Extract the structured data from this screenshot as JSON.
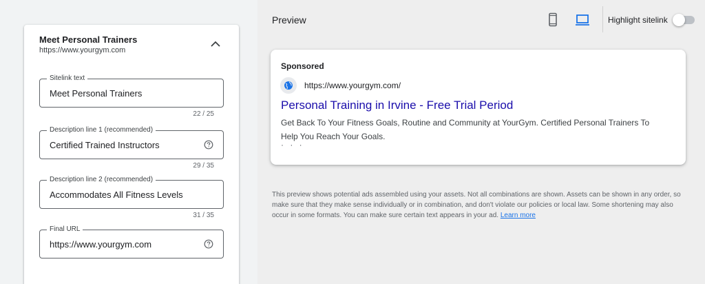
{
  "sitelink": {
    "title": "Meet Personal Trainers",
    "url": "https://www.yourgym.com",
    "collapse_icon": "chevron-up-icon",
    "fields": [
      {
        "label": "Sitelink text",
        "value": "Meet Personal Trainers",
        "counter": "22 / 25",
        "help": false
      },
      {
        "label": "Description line 1 (recommended)",
        "value": "Certified Trained Instructors",
        "counter": "29 / 35",
        "help": true
      },
      {
        "label": "Description line 2 (recommended)",
        "value": "Accommodates All Fitness Levels",
        "counter": "31 / 35",
        "help": false
      },
      {
        "label": "Final URL",
        "value": "https://www.yourgym.com",
        "counter": "",
        "help": true
      }
    ]
  },
  "preview": {
    "title": "Preview",
    "mobile_icon": "mobile-phone-icon",
    "desktop_icon": "laptop-icon",
    "highlight_label": "Highlight sitelink",
    "highlight_on": false,
    "ad": {
      "sponsored": "Sponsored",
      "url": "https://www.yourgym.com/",
      "headline": "Personal Training in Irvine - Free Trial Period",
      "description": "Get Back To Your Fitness Goals, Routine and Community at YourGym. Certified Personal Trainers To Help You Reach Your Goals.",
      "more": "· · ·"
    },
    "disclaimer": "This preview shows potential ads assembled using your assets. Not all combinations are shown. Assets can be shown in any order, so make sure that they make sense individually or in combination, and don't violate our policies or local law. Some shortening may also occur in some formats. You can make sure certain text appears in your ad.",
    "learn_more": "Learn more"
  },
  "colors": {
    "accent_blue": "#1a73e8",
    "headline_blue": "#1a0dab",
    "panel_bg": "#eeeeee"
  }
}
